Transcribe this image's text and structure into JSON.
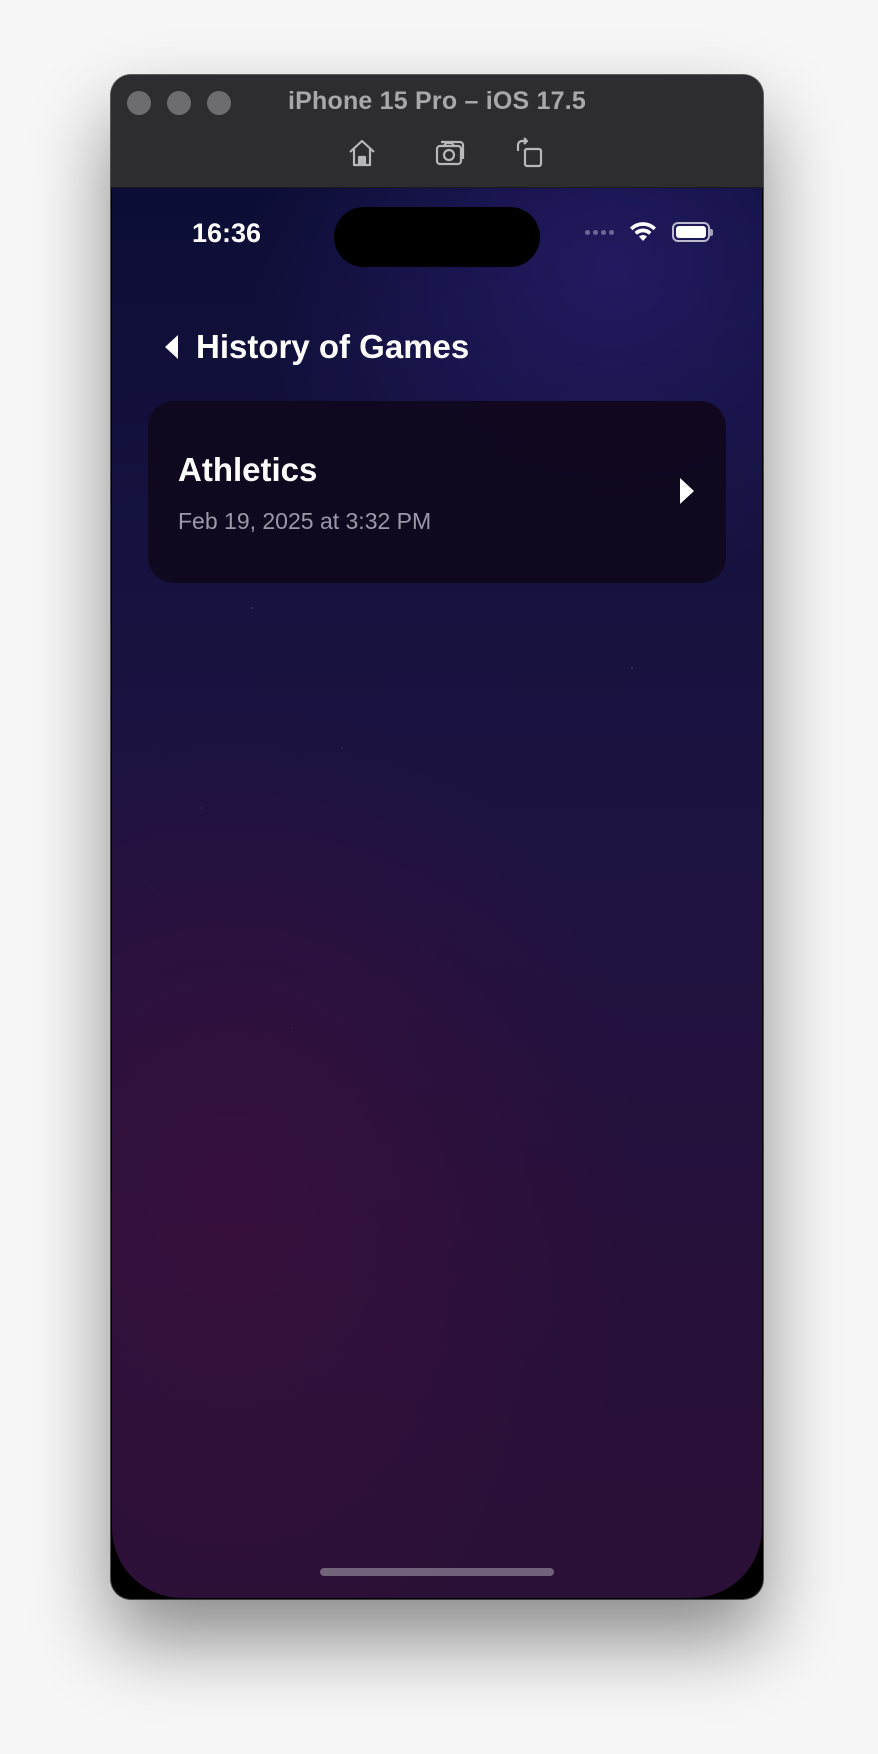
{
  "simulator": {
    "window_title": "iPhone 15 Pro – iOS 17.5",
    "toolbar": {
      "home_icon": "home-icon",
      "screenshot_icon": "camera-icon",
      "rotate_icon": "rotate-icon"
    }
  },
  "status_bar": {
    "time": "16:36",
    "wifi_icon": "wifi-icon",
    "battery_icon": "battery-icon",
    "battery_level": 1.0
  },
  "nav": {
    "back_icon": "chevron-left-icon",
    "title": "History of Games"
  },
  "history": {
    "items": [
      {
        "title": "Athletics",
        "date": "Feb 19, 2025 at 3:32 PM",
        "chevron_icon": "chevron-right-icon"
      }
    ]
  },
  "colors": {
    "background_top": "#0c0d34",
    "background_bottom": "#2a1036",
    "card_background": "#10081c",
    "primary_text": "#ffffff",
    "secondary_text": "#9c98a8"
  }
}
